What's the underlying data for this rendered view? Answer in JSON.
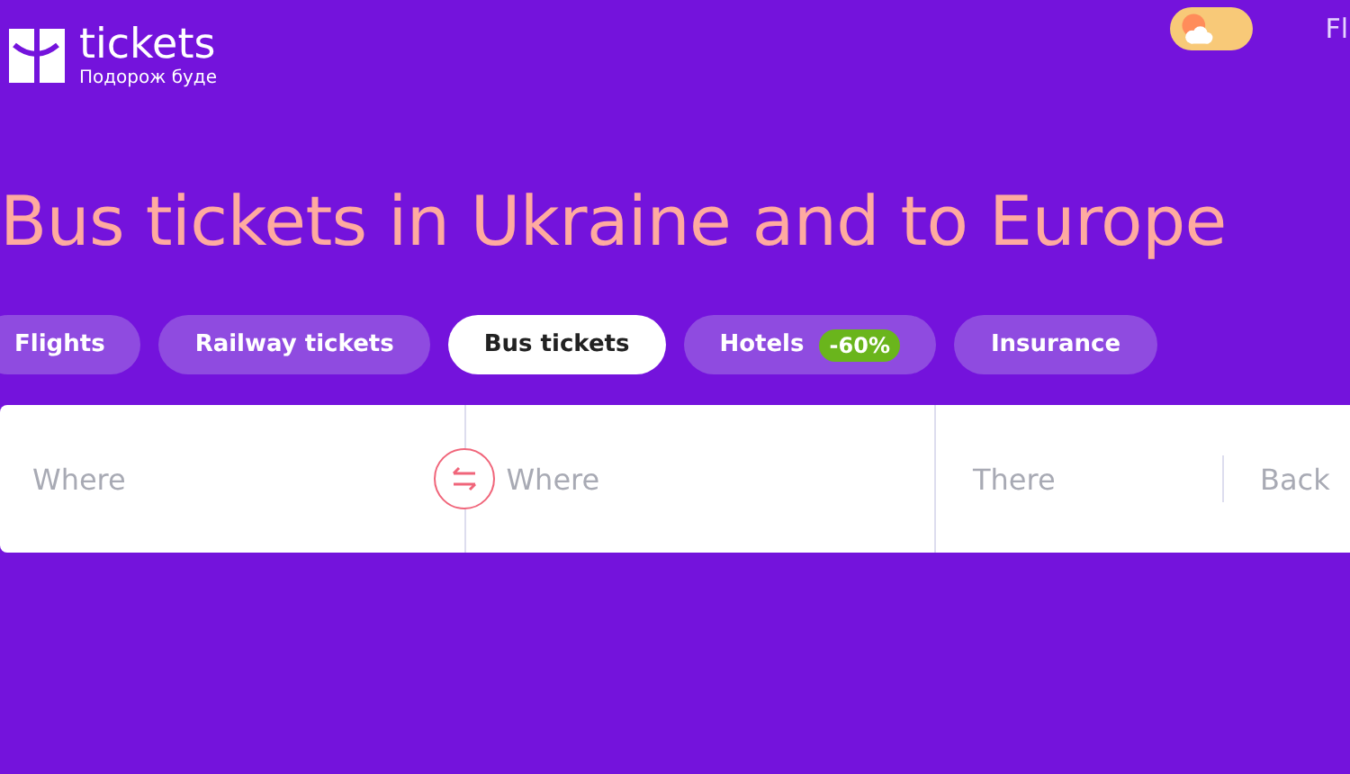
{
  "header": {
    "logo": {
      "name": "tickets",
      "tagline": "Подорож буде"
    },
    "nav_cut": "Fl",
    "theme_toggle": {
      "on": false
    }
  },
  "title": "Bus tickets in Ukraine and to Europe",
  "tabs": [
    {
      "label": "Flights",
      "selected": false
    },
    {
      "label": "Railway tickets",
      "selected": false
    },
    {
      "label": "Bus tickets",
      "selected": true
    },
    {
      "label": "Hotels",
      "selected": false,
      "badge": "-60%"
    },
    {
      "label": "Insurance",
      "selected": false
    }
  ],
  "search": {
    "from": {
      "placeholder": "Where"
    },
    "to": {
      "placeholder": "Where"
    },
    "date_there": {
      "placeholder": "There"
    },
    "date_back": {
      "placeholder": "Back"
    }
  }
}
